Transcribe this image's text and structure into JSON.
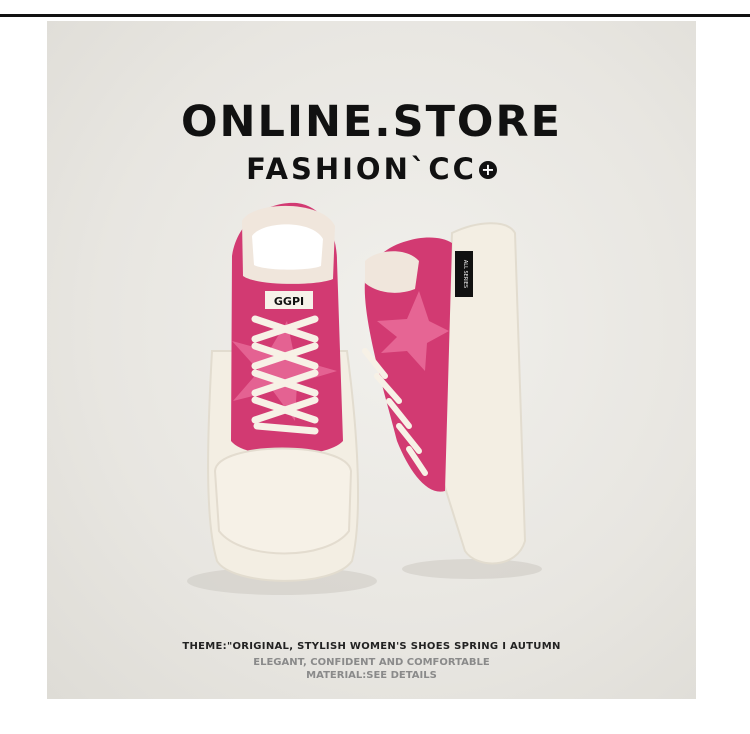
{
  "headline": "ONLINE.STORE",
  "subline": "FASHION`CC",
  "logo_symbol": "+",
  "shoe_tongue_text": "GGPI",
  "shoe_label_text": "ALL SERIES",
  "theme_line": "THEME:\"ORIGINAL, STYLISH WOMEN'S SHOES SPRING I AUTUMN",
  "tagline": "ELEGANT, CONFIDENT AND COMFORTABLE",
  "material_line": "MATERIAL:SEE DETAILS",
  "colors": {
    "suede_pink": "#d23a72",
    "sole_cream": "#f4efe4",
    "background": "#e8e6e1",
    "text": "#111111"
  }
}
